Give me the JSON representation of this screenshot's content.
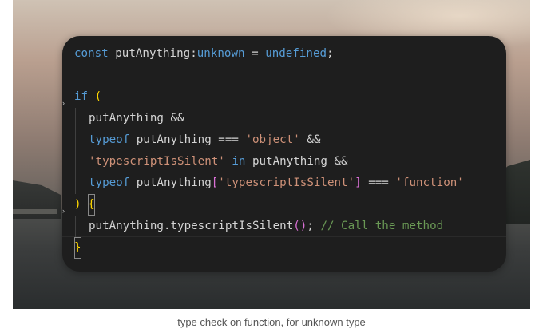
{
  "code": {
    "line1": {
      "kw_const": "const",
      "name": " putAnything:",
      "type": "unknown",
      "eq": " = ",
      "val": "undefined",
      "semi": ";"
    },
    "line3": {
      "kw_if": "if",
      "open": "("
    },
    "line4": {
      "text": "putAnything &&"
    },
    "line5": {
      "kw_typeof": "typeof",
      "name": " putAnything === ",
      "str": "'object'",
      "tail": " &&"
    },
    "line6": {
      "str": "'typescriptIsSilent'",
      "kw_in": " in",
      "tail": " putAnything &&"
    },
    "line7": {
      "kw_typeof": "typeof",
      "name": " putAnything",
      "bopen": "[",
      "str": "'typescriptIsSilent'",
      "bclose": "]",
      "eq": " === ",
      "str2": "'function'"
    },
    "line8": {
      "close": ")",
      "space": " ",
      "brace": "{"
    },
    "line9": {
      "call": "putAnything.typescriptIsSilent",
      "parens": "()",
      "semi": "; ",
      "comment": "// Call the method"
    },
    "line10": {
      "brace": "}"
    }
  },
  "caption": "type check on function, for unknown type",
  "colors": {
    "editor_bg": "#1e1e1e",
    "keyword": "#569cd6",
    "string": "#ce9178",
    "comment": "#6a9955",
    "bracket_yellow": "#ffd700",
    "bracket_purple": "#da70d6"
  }
}
